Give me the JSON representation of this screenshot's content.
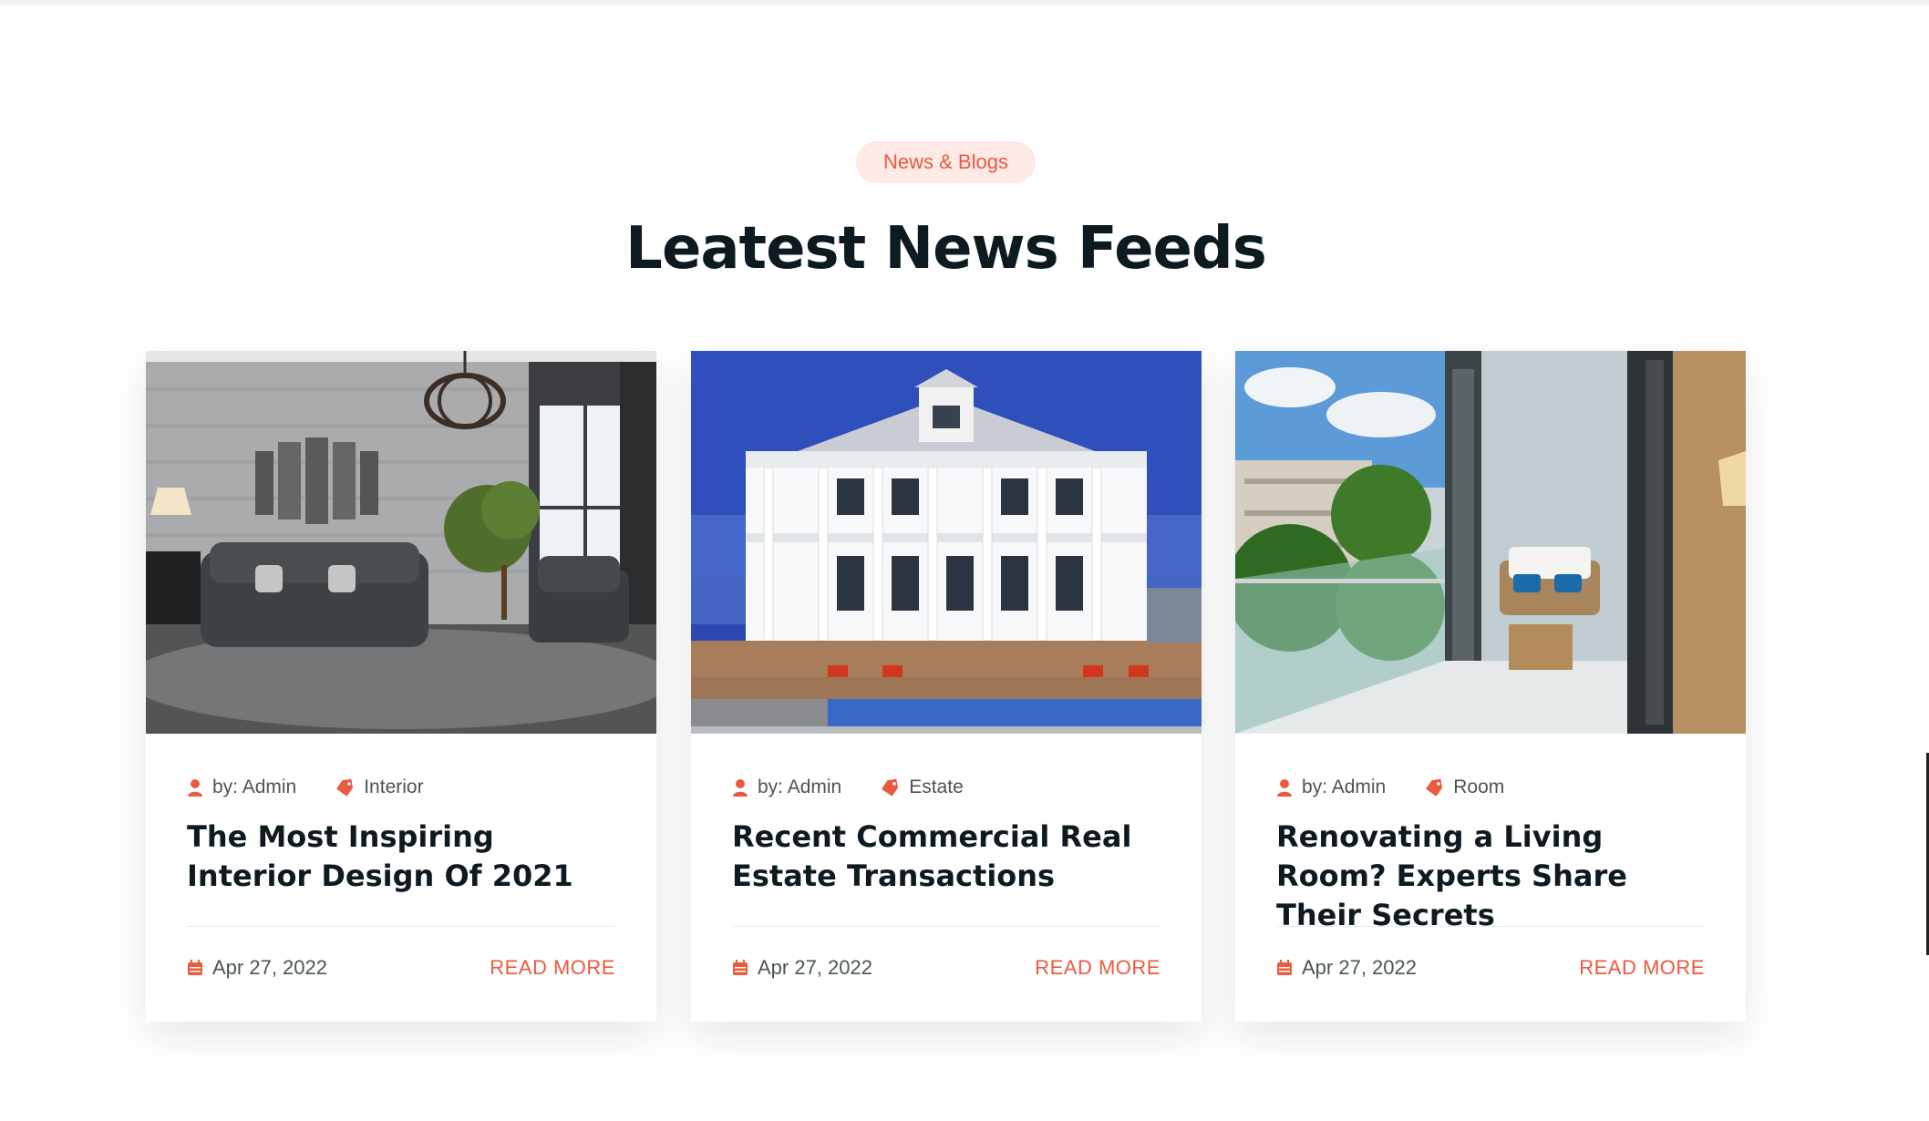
{
  "section": {
    "eyebrow": "News & Blogs",
    "title": "Leatest News Feeds"
  },
  "colors": {
    "accent": "#ea5a3f",
    "eyebrow_bg": "#fde9e5",
    "heading": "#0d1b21",
    "body_text": "#4a5458"
  },
  "cards": [
    {
      "author": "by: Admin",
      "category": "Interior",
      "title": "The Most Inspiring Interior Design Of 2021",
      "date": "Apr 27, 2022",
      "read_more": "READ MORE",
      "image": "living-room-photo"
    },
    {
      "author": "by: Admin",
      "category": "Estate",
      "title": "Recent Commercial Real Estate Transactions",
      "date": "Apr 27, 2022",
      "read_more": "READ MORE",
      "image": "beach-house-photo"
    },
    {
      "author": "by: Admin",
      "category": "Room",
      "title": "Renovating a Living Room? Experts Share Their Secrets",
      "date": "Apr 27, 2022",
      "read_more": "READ MORE",
      "image": "balcony-photo"
    }
  ],
  "icons": {
    "author": "user-icon",
    "category": "tag-icon",
    "date": "calendar-icon"
  }
}
